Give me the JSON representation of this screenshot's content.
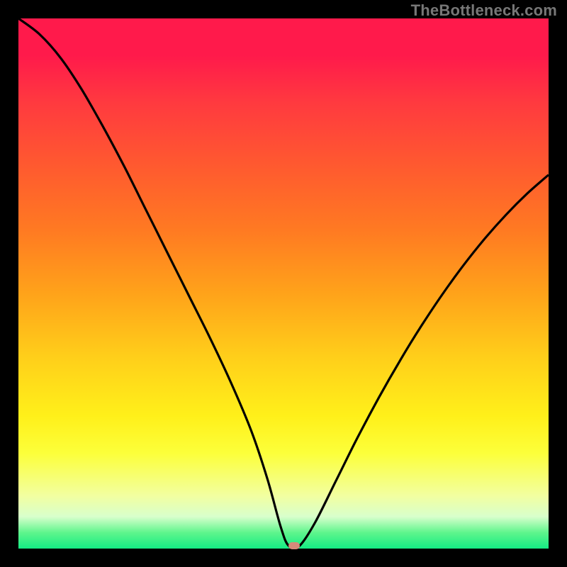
{
  "attribution": "TheBottleneck.com",
  "colors": {
    "page_bg": "#000000",
    "attribution": "#777777",
    "curve": "#000000",
    "marker": "#d48a7a",
    "gradient_top": "#ff1a4b",
    "gradient_bottom": "#14ec84"
  },
  "chart_data": {
    "type": "line",
    "title": "",
    "xlabel": "",
    "ylabel": "",
    "xlim": [
      0,
      100
    ],
    "ylim": [
      0,
      100
    ],
    "x": [
      0,
      4,
      8,
      12,
      16,
      20,
      24,
      28,
      32,
      36,
      40,
      44,
      47,
      49.5,
      51,
      53,
      56,
      60,
      64,
      68,
      72,
      76,
      80,
      84,
      88,
      92,
      96,
      100
    ],
    "values": [
      100,
      97,
      92.5,
      86.5,
      79.5,
      72,
      64,
      56,
      48,
      40,
      31.5,
      22,
      13,
      4,
      0.5,
      0.5,
      5,
      13,
      21,
      28.5,
      35.5,
      42,
      48,
      53.5,
      58.5,
      63,
      67,
      70.5
    ],
    "optimum_x": 52,
    "optimum_y": 0.5,
    "notes": "V-shaped bottleneck curve; minimum (optimum) marked by pink lozenge near x≈52. Values are read off the vertical gradient where top=100 (red/bad) and bottom=0 (green/good). No axis tick labels are shown."
  }
}
